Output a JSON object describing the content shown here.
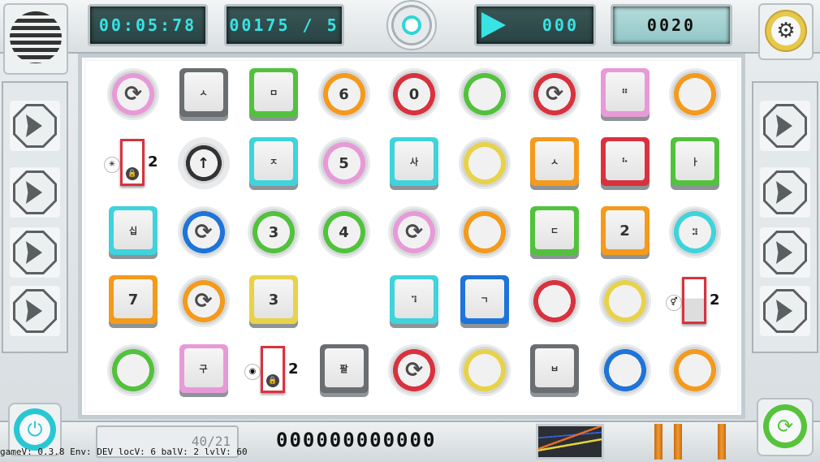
{
  "hud": {
    "timer": "00:05:78",
    "moves": "00175 / 5",
    "play_icon": "play-icon",
    "play_value": "000",
    "score": "0020"
  },
  "footer": {
    "version": "gameV: 0.3.8 Env: DEV locV: 6 balV: 2 lvlV: 60",
    "code": "000000000000",
    "sticker_text": "40/21"
  },
  "colors": {
    "pink": "#e79ad7",
    "gray": "#6b6e70",
    "green": "#52c23d",
    "orange": "#f49a1c",
    "red": "#d9323f",
    "yellow": "#e8d24a",
    "cyan": "#3fd3dc",
    "blue": "#1e74d8",
    "dark": "#333333"
  },
  "board": {
    "tiles": [
      {
        "shape": "circle",
        "color": "pink",
        "label": "⟳",
        "kind": "refresh"
      },
      {
        "shape": "square",
        "color": "gray",
        "label": "ㅅ",
        "kind": "text"
      },
      {
        "shape": "square",
        "color": "green",
        "label": "ㅁ",
        "kind": "text"
      },
      {
        "shape": "circle",
        "color": "orange",
        "label": "6",
        "kind": "num"
      },
      {
        "shape": "circle",
        "color": "red",
        "label": "0",
        "kind": "num"
      },
      {
        "shape": "circle",
        "color": "green",
        "label": "",
        "kind": "blank"
      },
      {
        "shape": "circle",
        "color": "red",
        "label": "⟳",
        "kind": "refresh"
      },
      {
        "shape": "square",
        "color": "pink",
        "label": "⠛",
        "kind": "text"
      },
      {
        "shape": "circle",
        "color": "orange",
        "label": "",
        "kind": "blank"
      },
      {
        "shape": "door",
        "pre": "✳",
        "count": "2"
      },
      {
        "shape": "circle",
        "color": "dark",
        "label": "↑",
        "kind": "arrow"
      },
      {
        "shape": "square",
        "color": "cyan",
        "label": "ㅈ",
        "kind": "text"
      },
      {
        "shape": "circle",
        "color": "pink",
        "label": "5",
        "kind": "num"
      },
      {
        "shape": "square",
        "color": "cyan",
        "label": "사",
        "kind": "text"
      },
      {
        "shape": "circle",
        "color": "yellow",
        "label": "",
        "kind": "blank"
      },
      {
        "shape": "square",
        "color": "orange",
        "label": "ㅅ",
        "kind": "text"
      },
      {
        "shape": "square",
        "color": "red",
        "label": "⠓",
        "kind": "text"
      },
      {
        "shape": "square",
        "color": "green",
        "label": "ㅏ",
        "kind": "text"
      },
      {
        "shape": "square",
        "color": "cyan",
        "label": "십",
        "kind": "text"
      },
      {
        "shape": "circle",
        "color": "blue",
        "label": "⟳",
        "kind": "refresh"
      },
      {
        "shape": "circle",
        "color": "green",
        "label": "3",
        "kind": "num"
      },
      {
        "shape": "circle",
        "color": "green",
        "label": "4",
        "kind": "num"
      },
      {
        "shape": "circle",
        "color": "pink",
        "label": "⟳",
        "kind": "refresh"
      },
      {
        "shape": "circle",
        "color": "orange",
        "label": "",
        "kind": "blank"
      },
      {
        "shape": "square",
        "color": "green",
        "label": "ㄷ",
        "kind": "text"
      },
      {
        "shape": "square",
        "color": "orange",
        "label": "2",
        "kind": "num"
      },
      {
        "shape": "circle",
        "color": "cyan",
        "label": "⠽",
        "kind": "text"
      },
      {
        "shape": "square",
        "color": "orange",
        "label": "7",
        "kind": "num"
      },
      {
        "shape": "circle",
        "color": "orange",
        "label": "⟳",
        "kind": "refresh"
      },
      {
        "shape": "square",
        "color": "yellow",
        "label": "3",
        "kind": "num"
      },
      {
        "shape": "empty"
      },
      {
        "shape": "square",
        "color": "cyan",
        "label": "⠹",
        "kind": "text"
      },
      {
        "shape": "square",
        "color": "blue",
        "label": "ㄱ",
        "kind": "text"
      },
      {
        "shape": "circle",
        "color": "red",
        "label": "",
        "kind": "blank"
      },
      {
        "shape": "circle",
        "color": "yellow",
        "label": "",
        "kind": "blank"
      },
      {
        "shape": "door",
        "pre": "⚥",
        "count": "2",
        "open": true
      },
      {
        "shape": "circle",
        "color": "green",
        "label": "",
        "kind": "blank"
      },
      {
        "shape": "square",
        "color": "pink",
        "label": "구",
        "kind": "text"
      },
      {
        "shape": "door",
        "pre": "◉",
        "count": "2"
      },
      {
        "shape": "square",
        "color": "gray",
        "label": "팔",
        "kind": "text"
      },
      {
        "shape": "circle",
        "color": "red",
        "label": "⟳",
        "kind": "refresh"
      },
      {
        "shape": "circle",
        "color": "yellow",
        "label": "",
        "kind": "blank"
      },
      {
        "shape": "square",
        "color": "gray",
        "label": "ㅂ",
        "kind": "text"
      },
      {
        "shape": "circle",
        "color": "blue",
        "label": "",
        "kind": "blank"
      },
      {
        "shape": "circle",
        "color": "orange",
        "label": "",
        "kind": "blank"
      }
    ]
  }
}
